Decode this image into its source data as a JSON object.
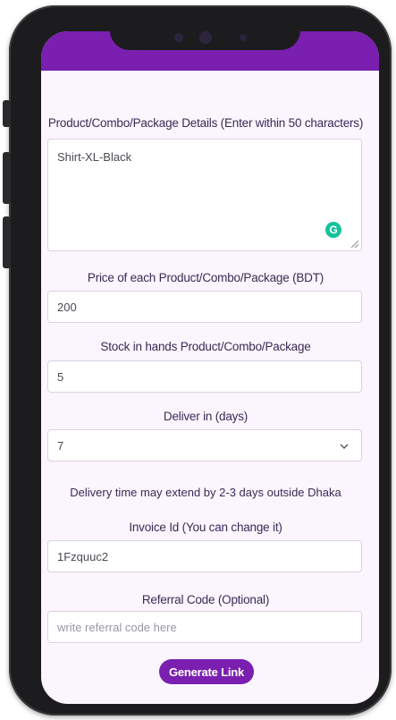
{
  "form": {
    "details_label": "Product/Combo/Package Details (Enter within 50 characters)",
    "details_value": "Shirt-XL-Black",
    "price_label": "Price of each Product/Combo/Package (BDT)",
    "price_value": "200",
    "stock_label": "Stock in hands Product/Combo/Package",
    "stock_value": "5",
    "deliver_label": "Deliver in (days)",
    "deliver_value": "7",
    "delivery_note": "Delivery time may extend by 2-3 days outside Dhaka",
    "invoice_label": "Invoice Id (You can change it)",
    "invoice_value": "1Fzquuc2",
    "referral_label": "Referral Code (Optional)",
    "referral_placeholder": "write referral code here",
    "generate_label": "Generate Link",
    "grammarly_glyph": "G"
  },
  "colors": {
    "accent": "#7a1fb0",
    "screen_bg": "#fbf6fd",
    "grammarly": "#15c39a"
  },
  "icons": [
    "grammarly-icon",
    "resize-handle-icon",
    "chevron-down-icon",
    "camera-icon"
  ]
}
